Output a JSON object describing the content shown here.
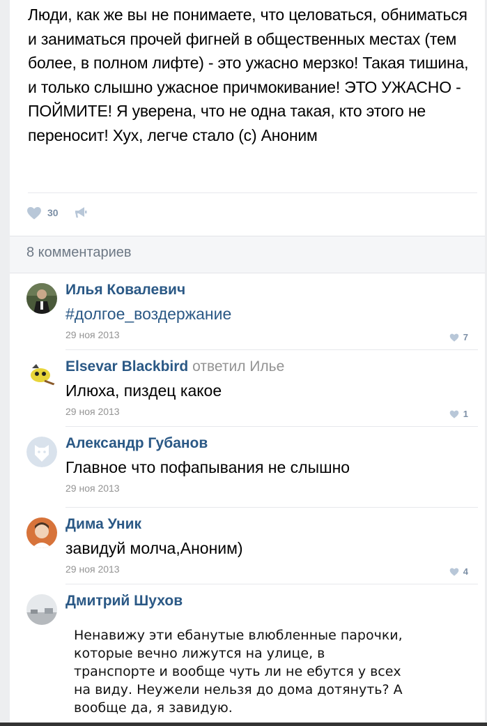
{
  "post": {
    "text": "Люди, как же вы не понимаете, что целоваться, обниматься и заниматься прочей фигней в общественных местах (тем более, в полном лифте) - это ужасно мерзко! Такая тишина, и только слышно ужасное причмокивание! ЭТО УЖАСНО - ПОЙМИТЕ! Я уверена, что не одна такая, кто этого не переносит! Хух, легче стало (с) Аноним",
    "likes": "30",
    "like_icon": "heart-icon",
    "share_icon": "megaphone-icon"
  },
  "comments_header": "8 комментариев",
  "comments": [
    {
      "author": "Илья Ковалевич",
      "reply_to": "",
      "text": "#долгое_воздержание",
      "date": "29 ноя 2013",
      "likes": "7"
    },
    {
      "author": "Elsevar Blackbird",
      "reply_to": "ответил Илье",
      "text": "Илюха, пиздец какое",
      "date": "29 ноя 2013",
      "likes": "1"
    },
    {
      "author": "Александр Губанов",
      "reply_to": "",
      "text": "Главное что пофапывания не слышно",
      "date": "29 ноя 2013",
      "likes": ""
    },
    {
      "author": "Дима Уник",
      "reply_to": "",
      "text": "завидуй молча,Аноним)",
      "date": "29 ноя 2013",
      "likes": "4"
    },
    {
      "author": "Дмитрий Шухов",
      "reply_to": "",
      "text": "",
      "date": "",
      "likes": ""
    }
  ],
  "embedded_image_text": "Ненавижу эти ебанутые влюбленные парочки, которые вечно лижутся на улице, в транспорте и вообще чуть ли не ебутся у всех на виду. Неужели нельзя до дома дотянуть? А вообще да, я завидую.",
  "colors": {
    "link": "#2a5885",
    "muted": "#939393",
    "like": "#7c8fa6",
    "divider": "#e7e8ec"
  }
}
